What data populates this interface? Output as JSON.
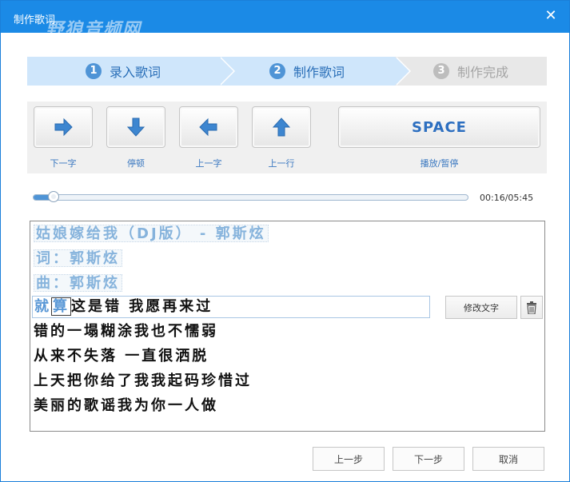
{
  "window": {
    "title": "制作歌词",
    "watermark": "野狼音频网",
    "close_icon": "close-icon"
  },
  "steps": [
    {
      "num": "1",
      "label": "录入歌词",
      "state": "done"
    },
    {
      "num": "2",
      "label": "制作歌词",
      "state": "active"
    },
    {
      "num": "3",
      "label": "制作完成",
      "state": "pending"
    }
  ],
  "toolbar": {
    "next_char_label": "下一字",
    "pause_label": "停顿",
    "prev_char_label": "上一字",
    "prev_line_label": "上一行",
    "space_text": "SPACE",
    "play_pause_label": "播放/暂停"
  },
  "player": {
    "time": "00:16/05:45",
    "progress": 0.046
  },
  "lyrics": {
    "done_lines": [
      "姑娘嫁给我（DJ版） - 郭斯炫",
      "词：郭斯炫",
      "曲：郭斯炫"
    ],
    "current_done": "就",
    "current_cursor": "算",
    "current_rest": "这是错 我愿再来过",
    "todo_lines": [
      "错的一塌糊涂我也不懦弱",
      "从来不失落 一直很洒脱",
      "上天把你给了我我起码珍惜过",
      "美丽的歌谣我为你一人做"
    ]
  },
  "actions": {
    "edit_text": "修改文字",
    "delete_icon": "trash-icon"
  },
  "footer": {
    "prev_step": "上一步",
    "next_step": "下一步",
    "cancel": "取消"
  },
  "colors": {
    "titlebar": "#1b8ae6",
    "accent": "#4f94d6",
    "step_active_bg": "#cfe6fb",
    "done_lyric": "#86b3dc"
  }
}
